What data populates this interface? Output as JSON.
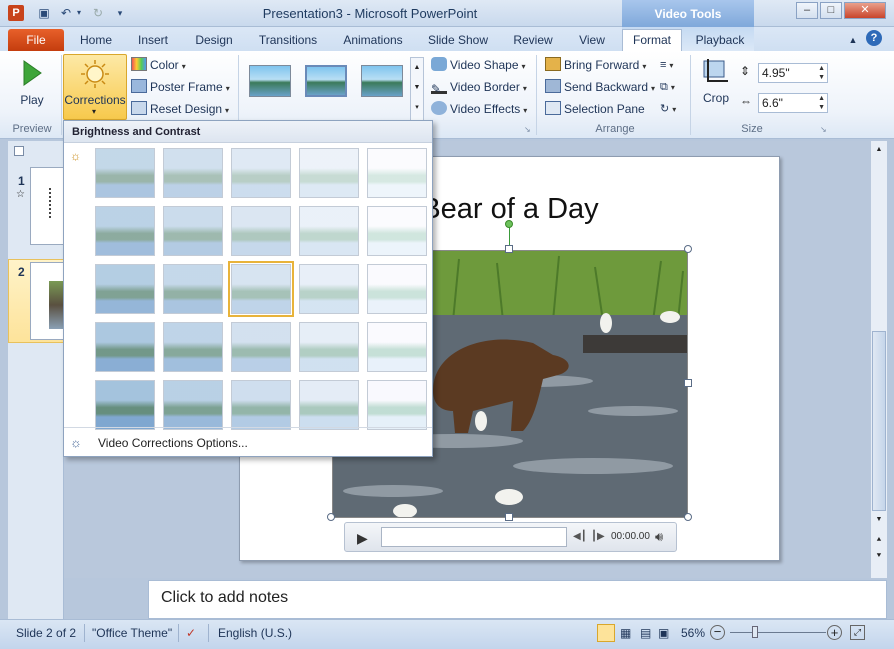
{
  "window": {
    "title": "Presentation3 - Microsoft PowerPoint",
    "context_header": "Video Tools",
    "app_icon": "P"
  },
  "tabs": {
    "file": "File",
    "home": "Home",
    "insert": "Insert",
    "design": "Design",
    "transitions": "Transitions",
    "animations": "Animations",
    "slide_show": "Slide Show",
    "review": "Review",
    "view": "View",
    "format": "Format",
    "playback": "Playback"
  },
  "ribbon": {
    "preview": {
      "play": "Play",
      "group": "Preview"
    },
    "adjust": {
      "corrections": "Corrections",
      "color": "Color",
      "poster_frame": "Poster Frame",
      "reset_design": "Reset Design"
    },
    "video_styles": {
      "shape": "Video Shape",
      "border": "Video Border",
      "effects": "Video Effects"
    },
    "arrange": {
      "bring_forward": "Bring Forward",
      "send_backward": "Send Backward",
      "selection_pane": "Selection Pane",
      "group": "Arrange"
    },
    "size": {
      "crop": "Crop",
      "height": "4.95\"",
      "width": "6.6\"",
      "group": "Size"
    }
  },
  "gallery": {
    "heading": "Brightness and Contrast",
    "options_link": "Video Corrections Options...",
    "rows": 5,
    "cols": 5,
    "selected": [
      2,
      2
    ]
  },
  "slide_panel": {
    "slides": [
      {
        "number": "1"
      },
      {
        "number": "2"
      }
    ]
  },
  "slide": {
    "title": "Bear of a Day"
  },
  "video_controls": {
    "time": "00:00.00"
  },
  "notes": {
    "placeholder": "Click to add notes"
  },
  "status": {
    "slide": "Slide 2 of 2",
    "theme": "\"Office Theme\"",
    "language": "English (U.S.)",
    "zoom": "56%",
    "zoom_level": 0.56
  },
  "colors": {
    "accent": "#f7c94c",
    "file_tab": "#c43d0e",
    "context_tab": "#7fa8da"
  }
}
